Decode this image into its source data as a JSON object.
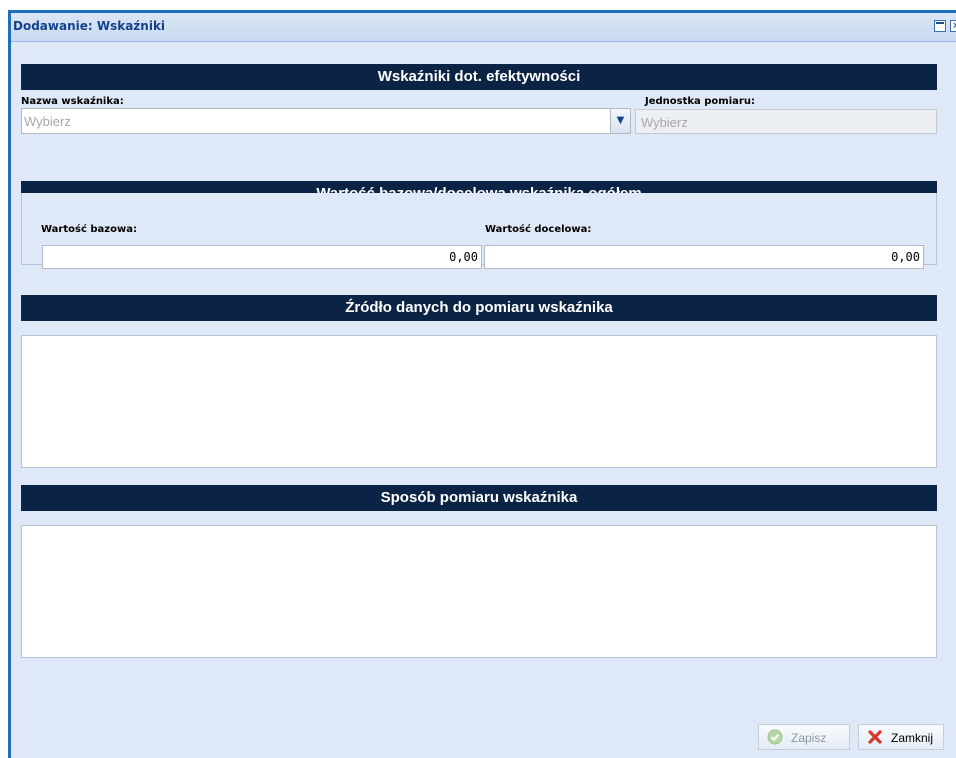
{
  "window": {
    "title": "Dodawanie: Wskaźniki"
  },
  "sections": {
    "efficiency": "Wskaźniki dot. efektywności",
    "values": "Wartość bazowa/docelowa wskaźnika ogółem",
    "data_source": "Źródło danych do pomiaru wskaźnika",
    "measurement_method": "Sposób pomiaru wskaźnika"
  },
  "fields": {
    "indicator_name_label": "Nazwa wskaźnika:",
    "indicator_name_placeholder": "Wybierz",
    "unit_label": "Jednostka pomiaru:",
    "unit_placeholder": "Wybierz",
    "base_value_label": "Wartość bazowa:",
    "base_value": "0,00",
    "target_value_label": "Wartość docelowa:",
    "target_value": "0,00",
    "data_source_value": "",
    "measurement_method_value": ""
  },
  "buttons": {
    "save": "Zapisz",
    "close": "Zamknij"
  },
  "colors": {
    "section_header": "#0b2345",
    "window_background": "#dfe8f6",
    "window_border": "#1f6fbd"
  }
}
